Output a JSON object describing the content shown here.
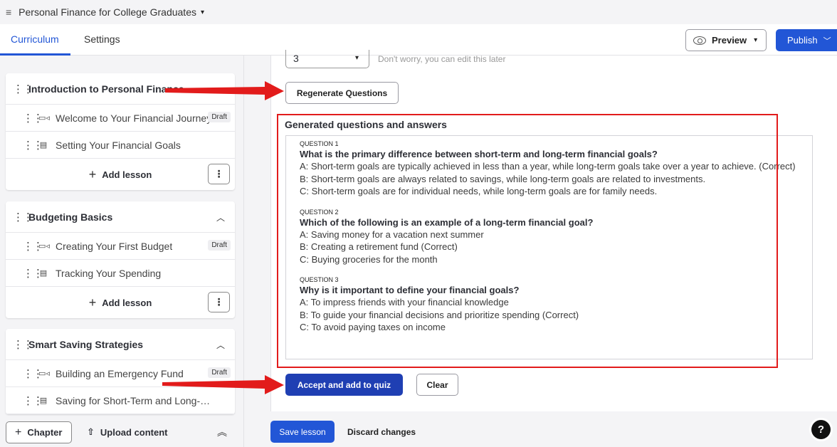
{
  "topbar": {
    "menu_icon": "hamburger-icon",
    "course_title": "Personal Finance for College Graduates",
    "caret": "▾"
  },
  "tabs": [
    {
      "label": "Curriculum",
      "active": true
    },
    {
      "label": "Settings",
      "active": false
    }
  ],
  "header_actions": {
    "preview_label": "Preview",
    "publish_label": "Publish"
  },
  "colors": {
    "accent": "#2256d6",
    "accept": "#1f3fb3",
    "annotation": "#e21b1b"
  },
  "sidebar": {
    "chapters": [
      {
        "title": "Introduction to Personal Finance",
        "lessons": [
          {
            "title": "Welcome to Your Financial Journey",
            "icon": "video-icon",
            "badge": "Draft"
          },
          {
            "title": "Setting Your Financial Goals",
            "icon": "document-icon",
            "badge": ""
          }
        ],
        "add_lesson": "Add lesson"
      },
      {
        "title": "Budgeting Basics",
        "lessons": [
          {
            "title": "Creating Your First Budget",
            "icon": "video-icon",
            "badge": "Draft"
          },
          {
            "title": "Tracking Your Spending",
            "icon": "document-icon",
            "badge": ""
          }
        ],
        "add_lesson": "Add lesson"
      },
      {
        "title": "Smart Saving Strategies",
        "lessons": [
          {
            "title": "Building an Emergency Fund",
            "icon": "video-icon",
            "badge": "Draft"
          },
          {
            "title": "Saving for Short-Term and Long-Term G...",
            "icon": "document-icon",
            "badge": ""
          }
        ]
      }
    ],
    "footer": {
      "chapter_label": "Chapter",
      "upload_label": "Upload content"
    }
  },
  "editor": {
    "question_count": "3",
    "question_count_hint": "Don't worry, you can edit this later",
    "regenerate_label": "Regenerate Questions",
    "generated_heading": "Generated questions and answers",
    "questions": [
      {
        "label": "QUESTION 1",
        "text": "What is the primary difference between short-term and long-term financial goals?",
        "answers": [
          "A: Short-term goals are typically achieved in less than a year, while long-term goals take over a year to achieve. (Correct)",
          "B: Short-term goals are always related to savings, while long-term goals are related to investments.",
          "C: Short-term goals are for individual needs, while long-term goals are for family needs."
        ]
      },
      {
        "label": "QUESTION 2",
        "text": "Which of the following is an example of a long-term financial goal?",
        "answers": [
          "A: Saving money for a vacation next summer",
          "B: Creating a retirement fund (Correct)",
          "C: Buying groceries for the month"
        ]
      },
      {
        "label": "QUESTION 3",
        "text": "Why is it important to define your financial goals?",
        "answers": [
          "A: To impress friends with your financial knowledge",
          "B: To guide your financial decisions and prioritize spending (Correct)",
          "C: To avoid paying taxes on income"
        ]
      }
    ],
    "accept_label": "Accept and add to quiz",
    "clear_label": "Clear"
  },
  "footer": {
    "save_label": "Save lesson",
    "discard_label": "Discard changes",
    "help_label": "?"
  }
}
